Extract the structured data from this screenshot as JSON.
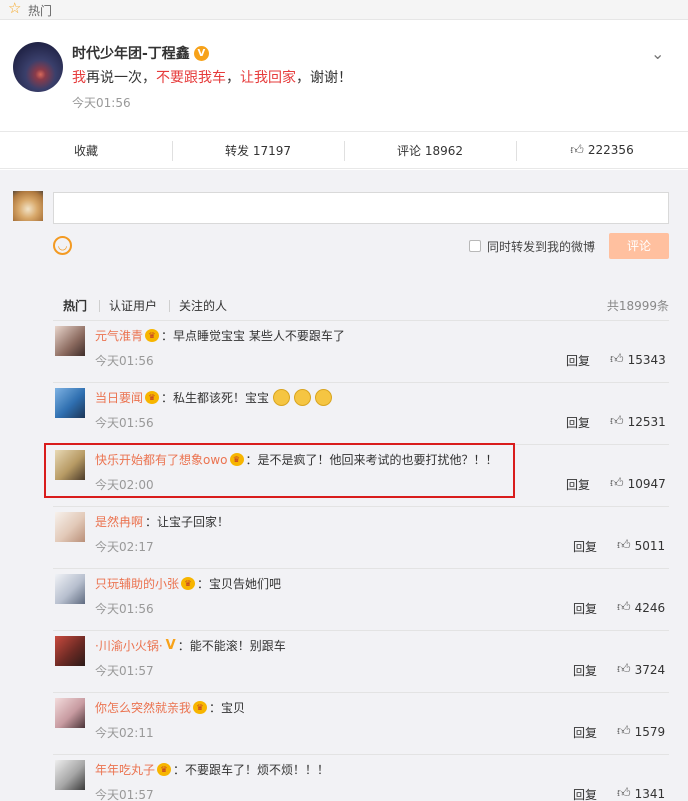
{
  "section_label": "热门",
  "post": {
    "author": "时代少年团-丁程鑫",
    "text_parts": [
      {
        "t": "我",
        "hl": true
      },
      {
        "t": "再说一次，",
        "hl": false
      },
      {
        "t": "不要跟我车",
        "hl": true
      },
      {
        "t": "，",
        "hl": false
      },
      {
        "t": "让我回家",
        "hl": true
      },
      {
        "t": "，谢谢！",
        "hl": false
      }
    ],
    "time": "今天01:56"
  },
  "actions": {
    "favorite": "收藏",
    "repost": "转发 17197",
    "comment": "评论 18962",
    "like": "222356"
  },
  "composer": {
    "placeholder": "",
    "sync_label": "同时转发到我的微博",
    "submit_label": "评论"
  },
  "comment_tabs": {
    "hot": "热门",
    "verified": "认证用户",
    "following": "关注的人",
    "total": "共18999条"
  },
  "comments": [
    {
      "user": "元气淮青",
      "badge": "crown",
      "text": "：早点睡觉宝宝 某些人不要跟车了",
      "emojis": 0,
      "time": "今天01:56",
      "reply": "回复",
      "likes": "15343"
    },
    {
      "user": "当日要闻",
      "badge": "crown",
      "text": "：私生都该死！宝宝",
      "emojis": 3,
      "time": "今天01:56",
      "reply": "回复",
      "likes": "12531"
    },
    {
      "user": "快乐开始都有了想象owo",
      "badge": "crown",
      "text": "：是不是疯了！他回来考试的也要打扰他？！！",
      "emojis": 0,
      "time": "今天02:00",
      "reply": "回复",
      "likes": "10947"
    },
    {
      "user": "是然冉啊",
      "badge": "none",
      "text": "：让宝子回家！",
      "emojis": 0,
      "time": "今天02:17",
      "reply": "回复",
      "likes": "5011"
    },
    {
      "user": "只玩辅助的小张",
      "badge": "crown",
      "text": "：宝贝告她们吧",
      "emojis": 0,
      "time": "今天01:56",
      "reply": "回复",
      "likes": "4246"
    },
    {
      "user": "·川渝小火锅·",
      "badge": "v",
      "text": "：能不能滚！别跟车",
      "emojis": 0,
      "time": "今天01:57",
      "reply": "回复",
      "likes": "3724"
    },
    {
      "user": "你怎么突然就亲我",
      "badge": "crown",
      "text": "：宝贝",
      "emojis": 0,
      "time": "今天02:11",
      "reply": "回复",
      "likes": "1579"
    },
    {
      "user": "年年吃丸子",
      "badge": "crown",
      "text": "：不要跟车了！烦不烦！！！",
      "emojis": 0,
      "time": "今天01:57",
      "reply": "回复",
      "likes": "1341"
    }
  ],
  "colors": {
    "accent": "#eb7350",
    "highlight_text": "#e63b3b",
    "box": "#d91c1c",
    "badge": "#f7a21a"
  }
}
